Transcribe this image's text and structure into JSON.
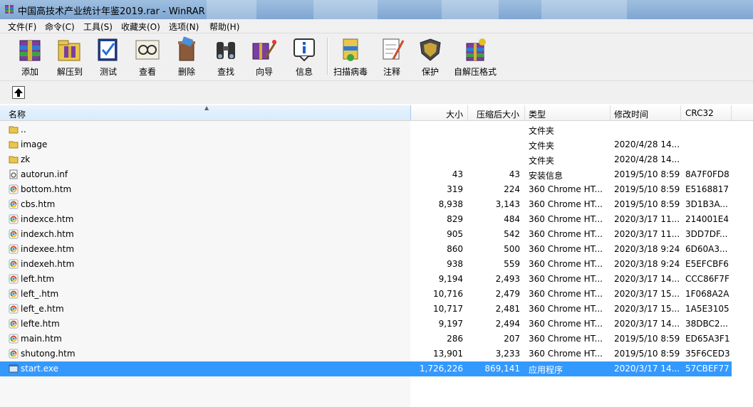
{
  "window": {
    "title": "中国高技术产业统计年鉴2019.rar - WinRAR"
  },
  "menu": [
    "文件(F)",
    "命令(C)",
    "工具(S)",
    "收藏夹(O)",
    "选项(N)",
    "帮助(H)"
  ],
  "toolbar": {
    "buttons": [
      {
        "label": "添加",
        "icon": "archive-add-icon"
      },
      {
        "label": "解压到",
        "icon": "extract-to-icon"
      },
      {
        "label": "测试",
        "icon": "test-archive-icon"
      },
      {
        "label": "查看",
        "icon": "view-icon"
      },
      {
        "label": "删除",
        "icon": "delete-icon"
      },
      {
        "label": "查找",
        "icon": "find-binoculars-icon"
      },
      {
        "label": "向导",
        "icon": "wizard-icon"
      },
      {
        "label": "信息",
        "icon": "info-icon"
      },
      {
        "label": "扫描病毒",
        "icon": "virus-scan-icon"
      },
      {
        "label": "注释",
        "icon": "comment-icon"
      },
      {
        "label": "保护",
        "icon": "protect-shield-icon"
      },
      {
        "label": "自解压格式",
        "icon": "sfx-icon"
      }
    ]
  },
  "columns": {
    "name": "名称",
    "size": "大小",
    "packed": "压缩后大小",
    "type": "类型",
    "modified": "修改时间",
    "crc": "CRC32"
  },
  "files": [
    {
      "name": "..",
      "size": "",
      "packed": "",
      "type": "文件夹",
      "modified": "",
      "crc": "",
      "icon": "folder"
    },
    {
      "name": "image",
      "size": "",
      "packed": "",
      "type": "文件夹",
      "modified": "2020/4/28 14...",
      "crc": "",
      "icon": "folder"
    },
    {
      "name": "zk",
      "size": "",
      "packed": "",
      "type": "文件夹",
      "modified": "2020/4/28 14...",
      "crc": "",
      "icon": "folder"
    },
    {
      "name": "autorun.inf",
      "size": "43",
      "packed": "43",
      "type": "安装信息",
      "modified": "2019/5/10 8:59",
      "crc": "8A7F0FD8",
      "icon": "inf"
    },
    {
      "name": "bottom.htm",
      "size": "319",
      "packed": "224",
      "type": "360 Chrome HT...",
      "modified": "2019/5/10 8:59",
      "crc": "E5168817",
      "icon": "htm"
    },
    {
      "name": "cbs.htm",
      "size": "8,938",
      "packed": "3,143",
      "type": "360 Chrome HT...",
      "modified": "2019/5/10 8:59",
      "crc": "3D1B3A...",
      "icon": "htm"
    },
    {
      "name": "indexce.htm",
      "size": "829",
      "packed": "484",
      "type": "360 Chrome HT...",
      "modified": "2020/3/17 11...",
      "crc": "214001E4",
      "icon": "htm"
    },
    {
      "name": "indexch.htm",
      "size": "905",
      "packed": "542",
      "type": "360 Chrome HT...",
      "modified": "2020/3/17 11...",
      "crc": "3DD7DF...",
      "icon": "htm"
    },
    {
      "name": "indexee.htm",
      "size": "860",
      "packed": "500",
      "type": "360 Chrome HT...",
      "modified": "2020/3/18 9:24",
      "crc": "6D60A3...",
      "icon": "htm"
    },
    {
      "name": "indexeh.htm",
      "size": "938",
      "packed": "559",
      "type": "360 Chrome HT...",
      "modified": "2020/3/18 9:24",
      "crc": "E5EFCBF6",
      "icon": "htm"
    },
    {
      "name": "left.htm",
      "size": "9,194",
      "packed": "2,493",
      "type": "360 Chrome HT...",
      "modified": "2020/3/17 14...",
      "crc": "CCC86F7F",
      "icon": "htm"
    },
    {
      "name": "left_.htm",
      "size": "10,716",
      "packed": "2,479",
      "type": "360 Chrome HT...",
      "modified": "2020/3/17 15...",
      "crc": "1F068A2A",
      "icon": "htm"
    },
    {
      "name": "left_e.htm",
      "size": "10,717",
      "packed": "2,481",
      "type": "360 Chrome HT...",
      "modified": "2020/3/17 15...",
      "crc": "1A5E3105",
      "icon": "htm"
    },
    {
      "name": "lefte.htm",
      "size": "9,197",
      "packed": "2,494",
      "type": "360 Chrome HT...",
      "modified": "2020/3/17 14...",
      "crc": "38DBC2...",
      "icon": "htm"
    },
    {
      "name": "main.htm",
      "size": "286",
      "packed": "207",
      "type": "360 Chrome HT...",
      "modified": "2019/5/10 8:59",
      "crc": "ED65A3F1",
      "icon": "htm"
    },
    {
      "name": "shutong.htm",
      "size": "13,901",
      "packed": "3,233",
      "type": "360 Chrome HT...",
      "modified": "2019/5/10 8:59",
      "crc": "35F6CED3",
      "icon": "htm"
    },
    {
      "name": "start.exe",
      "size": "1,726,226",
      "packed": "869,141",
      "type": "应用程序",
      "modified": "2020/3/17 14...",
      "crc": "57CBEF77",
      "icon": "exe",
      "selected": true
    }
  ]
}
